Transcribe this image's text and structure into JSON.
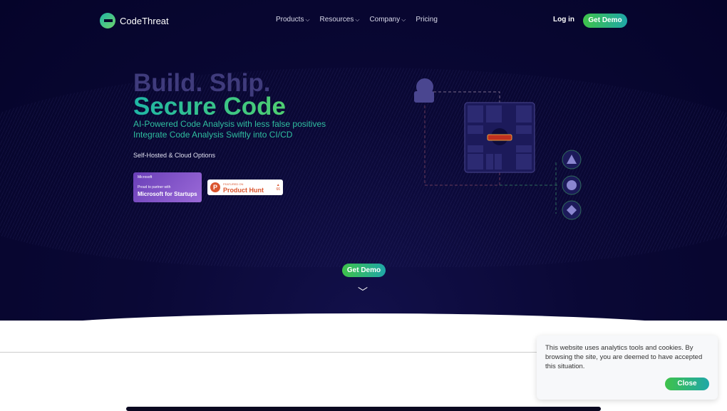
{
  "brand": {
    "name": "CodeThreat"
  },
  "nav": {
    "items": [
      "Products",
      "Resources",
      "Company",
      "Pricing"
    ],
    "login": "Log in",
    "demo": "Get Demo"
  },
  "hero": {
    "line1": "Build. Ship.",
    "line2": "Secure Code",
    "sub1": "AI-Powered Code Analysis with less false positives",
    "sub2": "Integrate Code Analysis Swiftly into CI/CD",
    "options": "Self-Hosted & Cloud Options",
    "demo": "Get Demo"
  },
  "badges": {
    "ms_brand": "Microsoft",
    "ms_small": "Proud to partner with",
    "ms_big": "Microsoft for Startups",
    "ph_small": "FEATURED ON",
    "ph_big": "Product Hunt",
    "ph_votes": "66"
  },
  "cookie": {
    "text": "This website uses analytics tools and cookies. By browsing the site, you are deemed to have accepted this situation.",
    "close": "Close"
  },
  "colors": {
    "bg": "#05042a",
    "accent_green": "#3fc24a",
    "accent_teal": "#1fa7a8"
  }
}
